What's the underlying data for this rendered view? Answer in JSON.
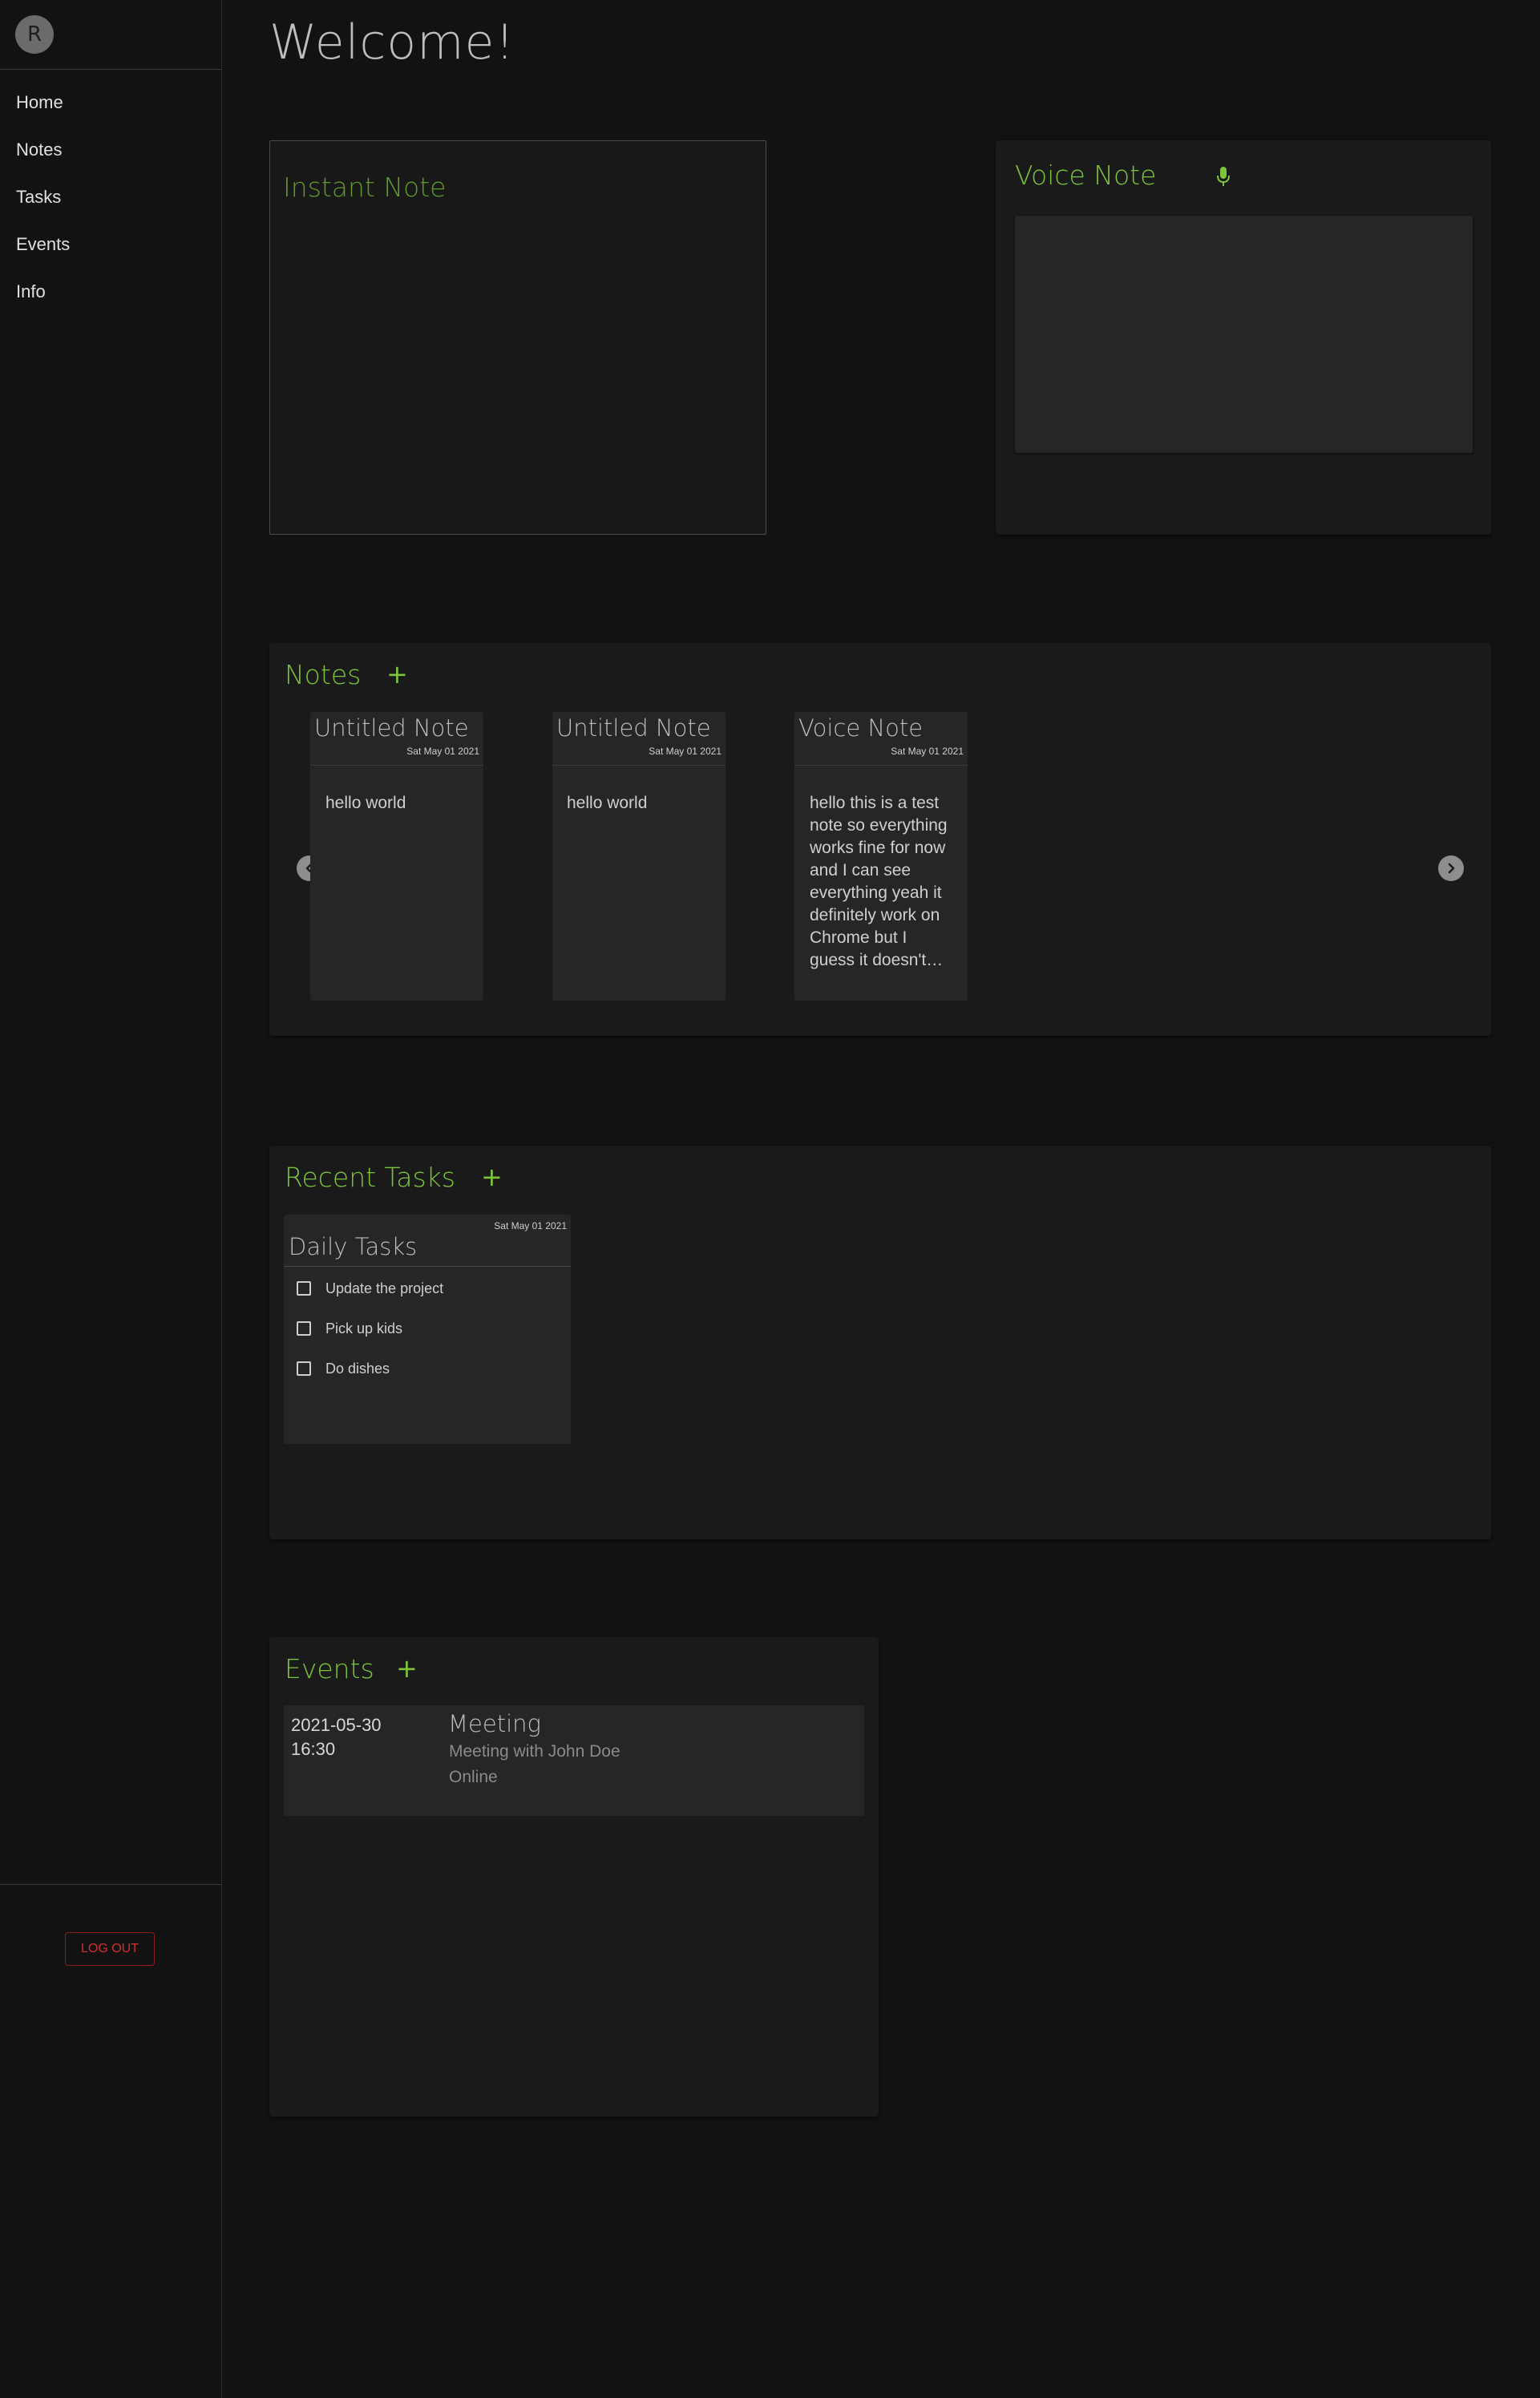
{
  "sidebar": {
    "avatar_initial": "R",
    "nav": [
      {
        "label": "Home"
      },
      {
        "label": "Notes"
      },
      {
        "label": "Tasks"
      },
      {
        "label": "Events"
      },
      {
        "label": "Info"
      }
    ],
    "logout_label": "LOG OUT"
  },
  "main": {
    "title": "Welcome!",
    "instant_note": {
      "title": "Instant Note"
    },
    "voice_note": {
      "title": "Voice Note",
      "icon": "microphone-icon"
    },
    "notes": {
      "title": "Notes",
      "add_label": "+",
      "cards": [
        {
          "title": "Untitled Note",
          "date": "Sat May 01 2021",
          "body": "hello world"
        },
        {
          "title": "Untitled Note",
          "date": "Sat May 01 2021",
          "body": "hello world"
        },
        {
          "title": "Voice Note",
          "date": "Sat May 01 2021",
          "body": "hello this is a test note so everything works fine for now and I can see everything yeah it definitely work on Chrome but I guess it doesn't…"
        }
      ]
    },
    "tasks": {
      "title": "Recent Tasks",
      "add_label": "+",
      "cards": [
        {
          "title": "Daily Tasks",
          "date": "Sat May 01 2021",
          "items": [
            {
              "label": "Update the project",
              "checked": false
            },
            {
              "label": "Pick up kids",
              "checked": false
            },
            {
              "label": "Do dishes",
              "checked": false
            }
          ]
        }
      ]
    },
    "events": {
      "title": "Events",
      "add_label": "+",
      "items": [
        {
          "date": "2021-05-30",
          "time": "16:30",
          "title": "Meeting",
          "description": "Meeting with John Doe",
          "location": "Online"
        }
      ]
    }
  },
  "colors": {
    "background": "#121212",
    "panel": "#1a1a1a",
    "card": "#262626",
    "accent": "#7cc43a",
    "danger": "#d32f2f"
  }
}
